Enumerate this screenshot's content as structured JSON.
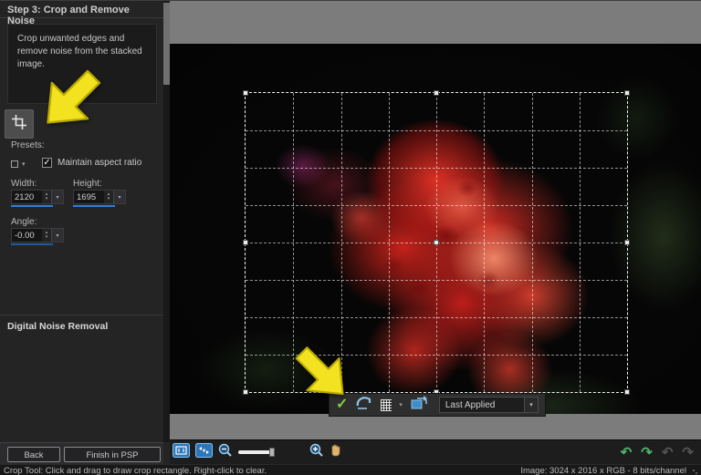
{
  "panel": {
    "title": "Step 3: Crop and Remove Noise",
    "description": "Crop unwanted edges and remove noise from the stacked image.",
    "presets_label": "Presets:",
    "maintain_aspect_label": "Maintain aspect ratio",
    "width_label": "Width:",
    "width_value": "2120",
    "height_label": "Height:",
    "height_value": "1695",
    "angle_label": "Angle:",
    "angle_value": "-0.00",
    "noise_section": "Digital Noise Removal",
    "back_button": "Back",
    "finish_button": "Finish in PSP"
  },
  "crop_toolbar": {
    "preset_value": "Last Applied"
  },
  "status_bar": {
    "left_text": "Crop Tool: Click and drag to draw crop rectangle. Right-click to clear.",
    "right_text": "Image:  3024 x 2016 x RGB - 8 bits/channel"
  },
  "icons": {
    "apply_check": "✓",
    "checkbox_check": "✓",
    "dropdown_arrow": "▾",
    "spinner_up": "▴",
    "spinner_down": "▾",
    "undo": "↶",
    "redo": "↷"
  },
  "colors": {
    "accent_blue": "#2e7fd8",
    "apply_green": "#83c940",
    "arrow_yellow": "#f2e21f",
    "canvas_gray": "#7c7c7c",
    "panel_bg": "#242424"
  }
}
